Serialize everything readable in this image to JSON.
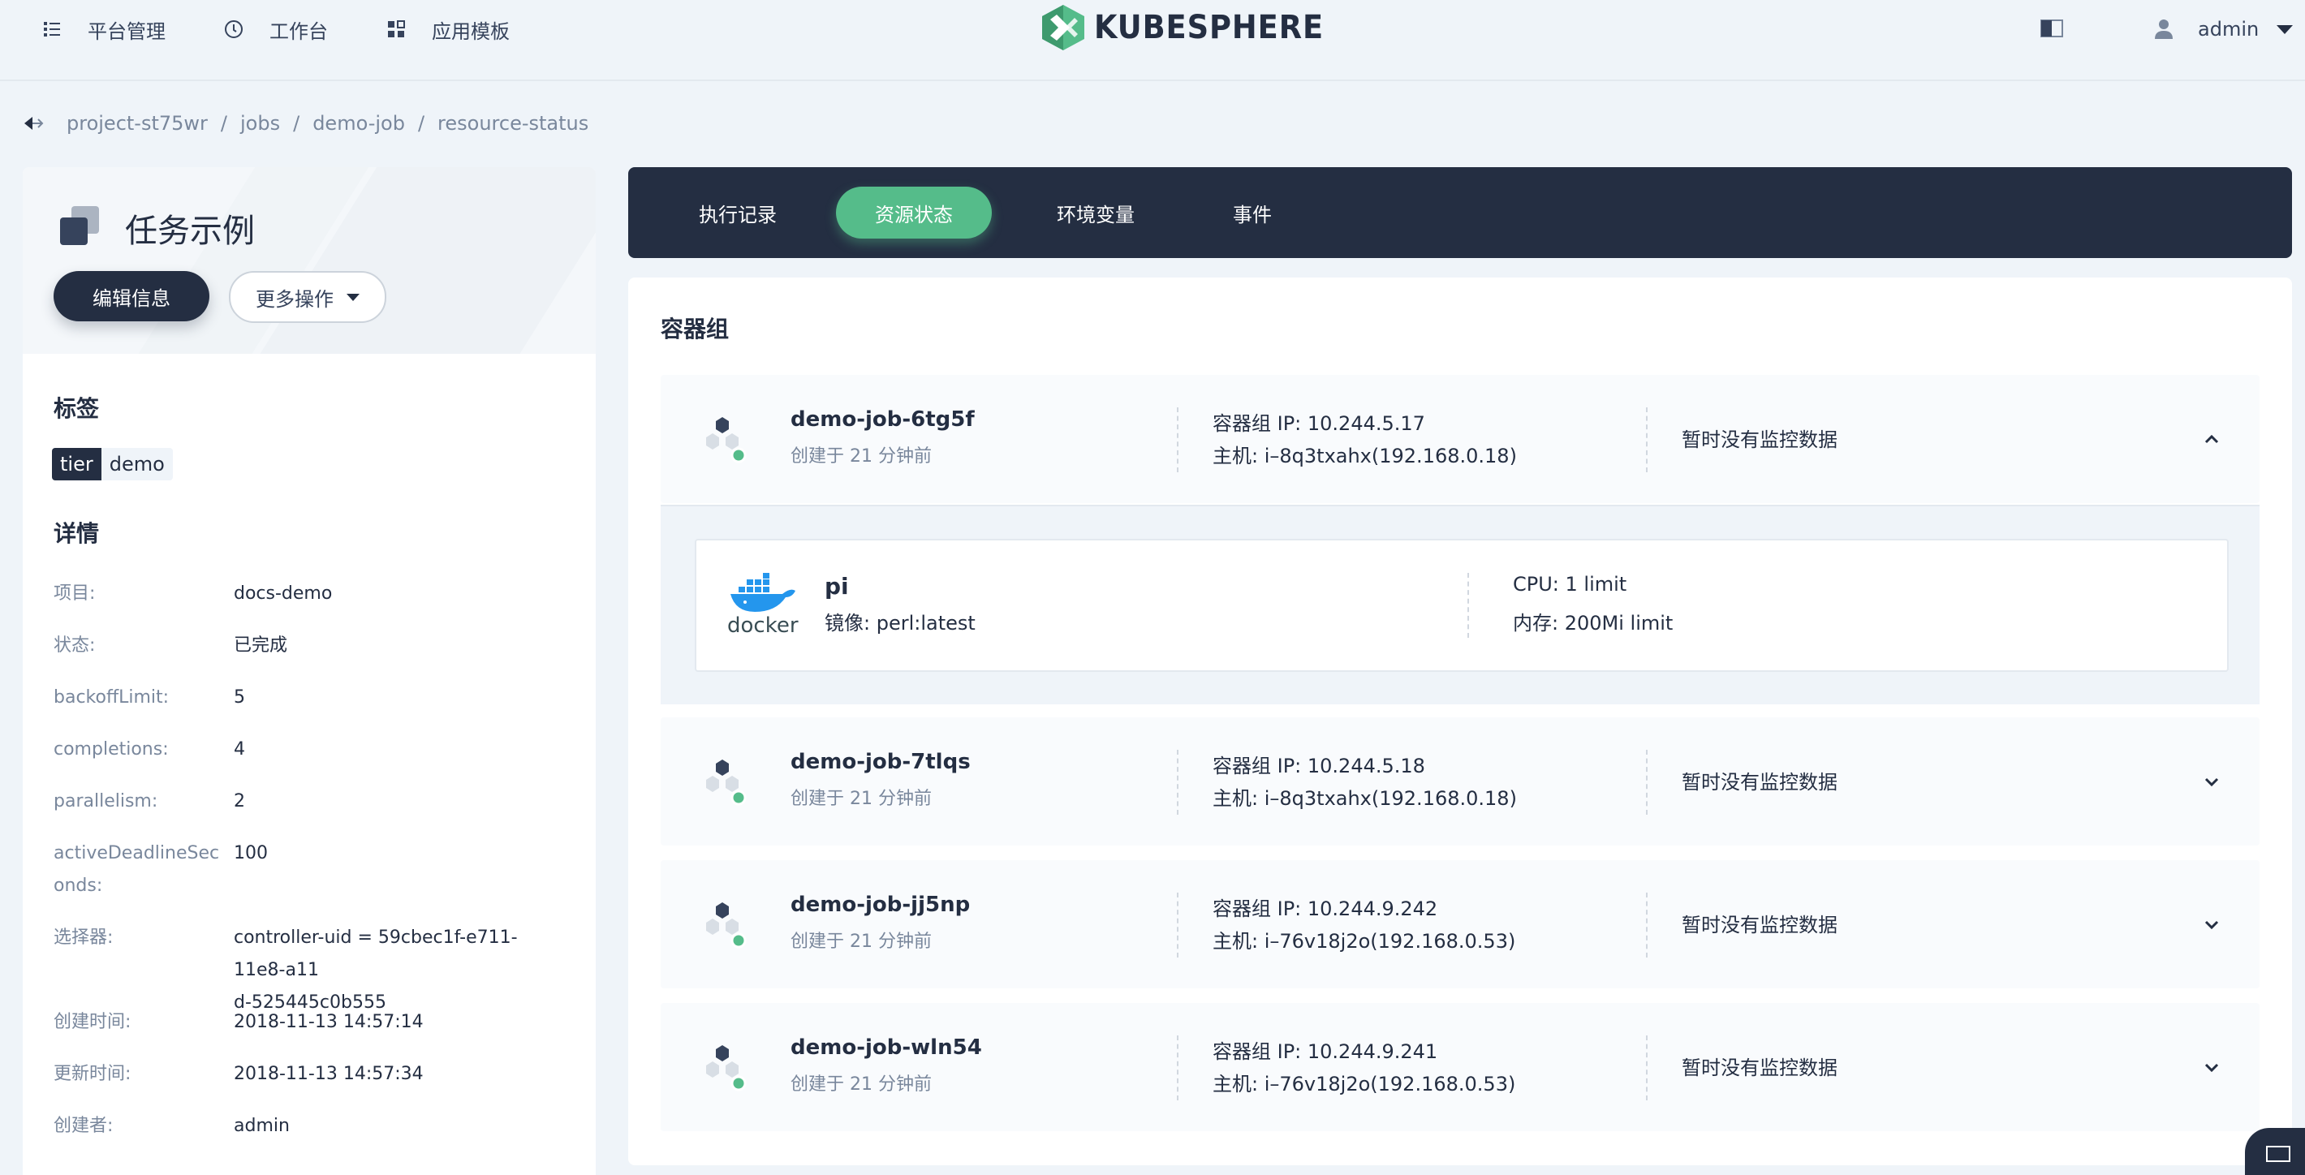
{
  "topnav": {
    "items": [
      {
        "label": "平台管理",
        "icon": "platform-icon"
      },
      {
        "label": "工作台",
        "icon": "workbench-icon"
      },
      {
        "label": "应用模板",
        "icon": "app-template-icon"
      }
    ],
    "logo": "KUBESPHERE",
    "user": "admin"
  },
  "breadcrumb": [
    "project-st75wr",
    "jobs",
    "demo-job",
    "resource-status"
  ],
  "sidebar": {
    "title": "任务示例",
    "edit_label": "编辑信息",
    "more_label": "更多操作",
    "labels_title": "标签",
    "tag": {
      "key": "tier",
      "value": "demo"
    },
    "details_title": "详情",
    "details": [
      {
        "label": "项目:",
        "value": "docs-demo"
      },
      {
        "label": "状态:",
        "value": "已完成"
      },
      {
        "label": "backoffLimit:",
        "value": "5"
      },
      {
        "label": "completions:",
        "value": "4"
      },
      {
        "label": "parallelism:",
        "value": "2"
      },
      {
        "label_line1": "activeDeadlineSec",
        "label_line2": "onds:",
        "value": "100"
      },
      {
        "label": "选择器:",
        "value_line1": "controller-uid = 59cbec1f-e711-11e8-a11",
        "value_line2": "d-525445c0b555"
      },
      {
        "label": "创建时间:",
        "value": "2018-11-13 14:57:14"
      },
      {
        "label": "更新时间:",
        "value": "2018-11-13 14:57:34"
      },
      {
        "label": "创建者:",
        "value": "admin"
      }
    ]
  },
  "tabs": [
    {
      "label": "执行记录",
      "active": false
    },
    {
      "label": "资源状态",
      "active": true
    },
    {
      "label": "环境变量",
      "active": false
    },
    {
      "label": "事件",
      "active": false
    }
  ],
  "main": {
    "title": "容器组",
    "pods": [
      {
        "name": "demo-job-6tg5f",
        "created": "创建于 21 分钟前",
        "ip": "容器组 IP: 10.244.5.17",
        "host": "主机: i–8q3txahx(192.168.0.18)",
        "monitor": "暂时没有监控数据",
        "expanded": true
      },
      {
        "name": "demo-job-7tlqs",
        "created": "创建于 21 分钟前",
        "ip": "容器组 IP: 10.244.5.18",
        "host": "主机: i–8q3txahx(192.168.0.18)",
        "monitor": "暂时没有监控数据",
        "expanded": false
      },
      {
        "name": "demo-job-jj5np",
        "created": "创建于 21 分钟前",
        "ip": "容器组 IP: 10.244.9.242",
        "host": "主机: i–76v18j2o(192.168.0.53)",
        "monitor": "暂时没有监控数据",
        "expanded": false
      },
      {
        "name": "demo-job-wln54",
        "created": "创建于 21 分钟前",
        "ip": "容器组 IP: 10.244.9.241",
        "host": "主机: i–76v18j2o(192.168.0.53)",
        "monitor": "暂时没有监控数据",
        "expanded": false
      }
    ],
    "container": {
      "name": "pi",
      "logo_text": "docker",
      "image": "镜像: perl:latest",
      "cpu": "CPU: 1 limit",
      "memory": "内存: 200Mi limit"
    }
  },
  "colors": {
    "dark": "#242e42",
    "accent": "#55bc8a",
    "background": "#eff4f9",
    "docker": "#2496ed"
  }
}
